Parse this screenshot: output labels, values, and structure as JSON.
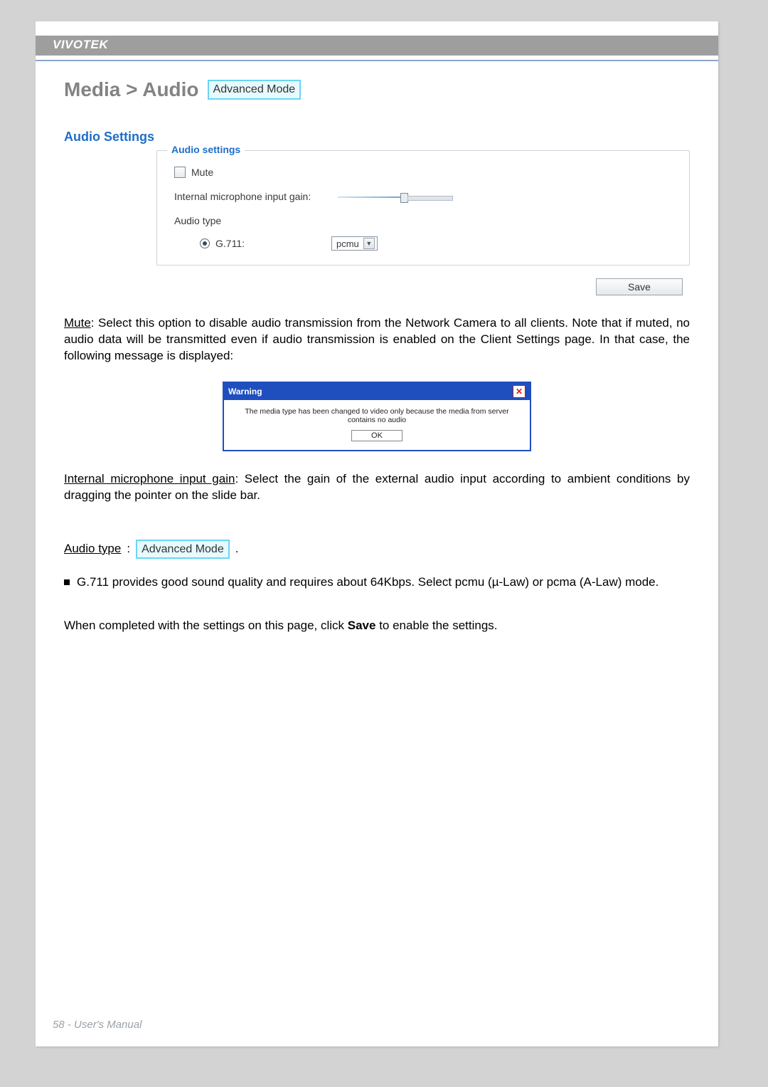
{
  "brand": "VIVOTEK",
  "breadcrumb": "Media > Audio",
  "advanced_badge": "Advanced Mode",
  "section_title": "Audio Settings",
  "fieldset": {
    "legend": "Audio settings",
    "mute_label": "Mute",
    "gain_label": "Internal microphone input gain:",
    "audio_type_label": "Audio type",
    "g711_label": "G.711:",
    "codec_value": "pcmu"
  },
  "save_label": "Save",
  "para_mute_lead": "Mute",
  "para_mute_rest": ": Select this option to disable audio transmission from the Network Camera to all clients. Note that if muted, no audio data will be transmitted even if audio transmission is enabled on the Client Settings page. In that case, the following message is displayed:",
  "warning": {
    "title": "Warning",
    "body": "The media type has been changed to video only because the media from server contains no audio",
    "ok": "OK"
  },
  "para_gain_lead": "Internal microphone input gain",
  "para_gain_rest": ": Select the gain of the external audio input according to ambient conditions by dragging the pointer on the slide bar.",
  "audio_type_lead": "Audio type",
  "audio_type_badge": "Advanced Mode",
  "audio_type_trail": ".",
  "bullet_g711": "G.711 provides good sound quality and requires about 64Kbps. Select pcmu (µ-Law) or pcma (A-Law) mode.",
  "para_save_1": "When completed with the settings on this page, click ",
  "para_save_bold": "Save",
  "para_save_2": " to enable the settings.",
  "footer": "58 - User's Manual"
}
